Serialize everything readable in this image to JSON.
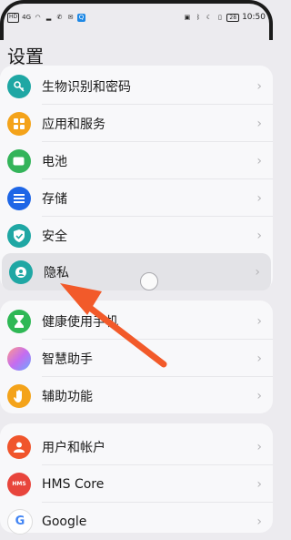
{
  "status": {
    "left_icons": [
      "HD",
      "4G",
      "wifi",
      "signal",
      "call",
      "msg",
      "Q"
    ],
    "time": "10:50",
    "battery": "28"
  },
  "page": {
    "title": "设置"
  },
  "groups": [
    {
      "items": [
        {
          "label": "生物识别和密码",
          "icon": "key-icon",
          "color": "#1fa7a4"
        },
        {
          "label": "应用和服务",
          "icon": "apps-icon",
          "color": "#f4a31a"
        },
        {
          "label": "电池",
          "icon": "battery-icon",
          "color": "#34b45a"
        },
        {
          "label": "存储",
          "icon": "storage-icon",
          "color": "#1e66e6"
        },
        {
          "label": "安全",
          "icon": "shield-check-icon",
          "color": "#1fa7a4"
        },
        {
          "label": "隐私",
          "icon": "privacy-icon",
          "color": "#1fa7a4"
        }
      ]
    },
    {
      "items": [
        {
          "label": "健康使用手机",
          "icon": "hourglass-icon",
          "color": "#2fb855"
        },
        {
          "label": "智慧助手",
          "icon": "assistant-icon",
          "color": "#c56cf0"
        },
        {
          "label": "辅助功能",
          "icon": "hand-icon",
          "color": "#f4a31a"
        }
      ]
    },
    {
      "items": [
        {
          "label": "用户和帐户",
          "icon": "user-icon",
          "color": "#f0552c"
        },
        {
          "label": "HMS Core",
          "icon": "hms-icon",
          "color": "#e8453c"
        },
        {
          "label": "Google",
          "icon": "google-icon",
          "color": "#4285f4"
        }
      ]
    }
  ],
  "chevron": "›",
  "annotation": {
    "arrow_color": "#f25a2a"
  }
}
